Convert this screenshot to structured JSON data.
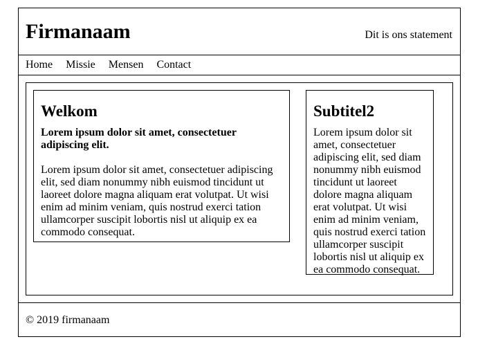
{
  "header": {
    "brand": "Firmanaam",
    "statement": "Dit is ons statement"
  },
  "nav": {
    "items": [
      "Home",
      "Missie",
      "Mensen",
      "Contact"
    ]
  },
  "main": {
    "title": "Welkom",
    "lead": "Lorem ipsum dolor sit amet, consectetuer adipiscing elit.",
    "body": "Lorem ipsum dolor sit amet, consectetuer adipiscing elit, sed diam nonummy nibh euismod tincidunt ut laoreet dolore magna aliquam erat volutpat. Ut wisi enim ad minim veniam, quis nostrud exerci tation ullamcorper suscipit lobortis nisl ut aliquip ex ea commodo consequat."
  },
  "sidebar": {
    "title": "Subtitel2",
    "body": "Lorem ipsum dolor sit amet, consectetuer adipiscing elit, sed diam nonummy nibh euismod tincidunt ut laoreet dolore magna aliquam erat volutpat. Ut wisi enim ad minim veniam, quis nostrud exerci tation ullamcorper suscipit lobortis nisl ut aliquip ex ea commodo consequat."
  },
  "footer": {
    "copyright": "© 2019 firmanaam"
  }
}
